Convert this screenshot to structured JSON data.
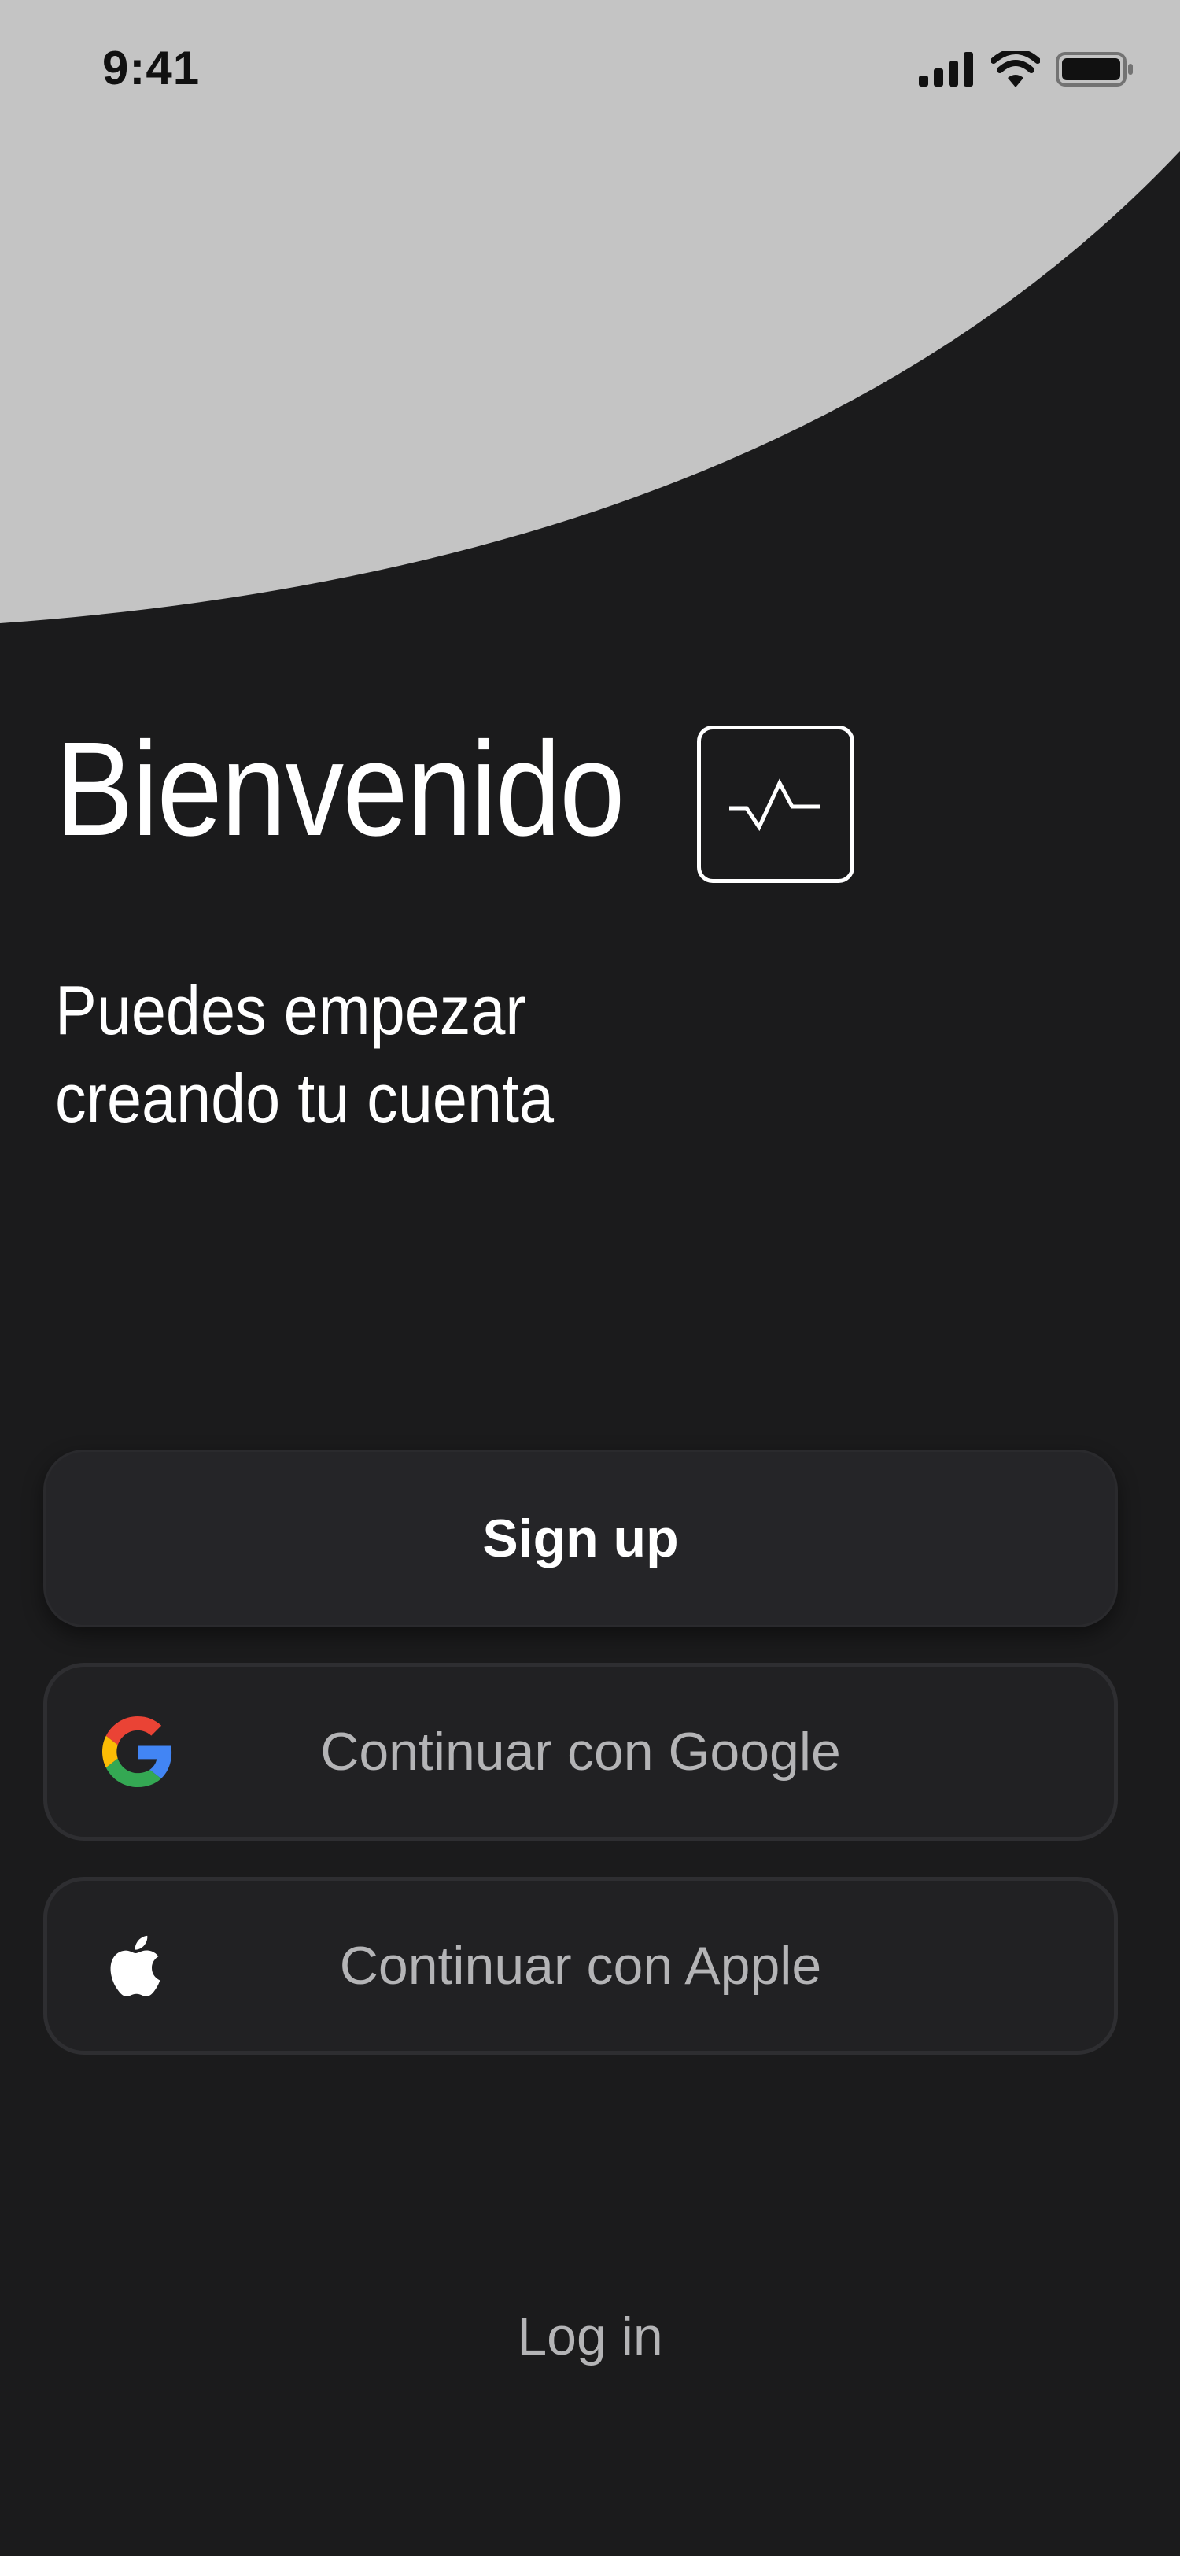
{
  "status_bar": {
    "time": "9:41"
  },
  "welcome": {
    "title": "Bienvenido",
    "logo_icon": "pulse-icon",
    "subtitle_line1": "Puedes empezar",
    "subtitle_line2": "creando tu cuenta"
  },
  "buttons": {
    "signup_label": "Sign up",
    "google_label": "Continuar con Google",
    "google_icon": "google-icon",
    "apple_label": "Continuar con Apple",
    "apple_icon": "apple-icon"
  },
  "footer": {
    "login_label": "Log in"
  },
  "colors": {
    "background": "#1b1b1c",
    "top_shape": "#c4c4c4",
    "signup_button": "#252528",
    "outline_button": "#212123",
    "muted_text": "#b4b4b6"
  }
}
